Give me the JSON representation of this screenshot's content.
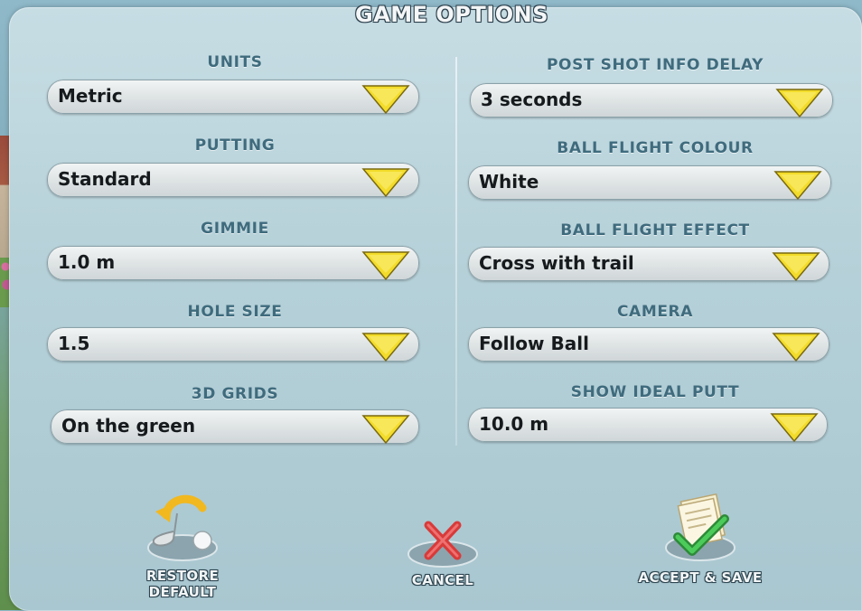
{
  "window": {
    "title": "GAME OPTIONS"
  },
  "left_options": [
    {
      "label": "UNITS",
      "value": "Metric"
    },
    {
      "label": "PUTTING",
      "value": "Standard"
    },
    {
      "label": "GIMMIE",
      "value": "1.0 m"
    },
    {
      "label": "HOLE SIZE",
      "value": "1.5"
    },
    {
      "label": "3D GRIDS",
      "value": "On the green"
    }
  ],
  "right_options": [
    {
      "label": "POST SHOT INFO DELAY",
      "value": "3 seconds"
    },
    {
      "label": "BALL FLIGHT COLOUR",
      "value": "White"
    },
    {
      "label": "BALL FLIGHT EFFECT",
      "value": "Cross with trail"
    },
    {
      "label": "CAMERA",
      "value": "Follow Ball"
    },
    {
      "label": "SHOW IDEAL PUTT",
      "value": "10.0 m"
    }
  ],
  "actions": {
    "restore_line1": "RESTORE",
    "restore_line2": "DEFAULT",
    "cancel": "CANCEL",
    "accept": "ACCEPT & SAVE"
  },
  "colors": {
    "arrow": "#f3dc2a",
    "label": "#3f6b7d",
    "cancel": "#d83a3a",
    "accept": "#38b34a"
  }
}
